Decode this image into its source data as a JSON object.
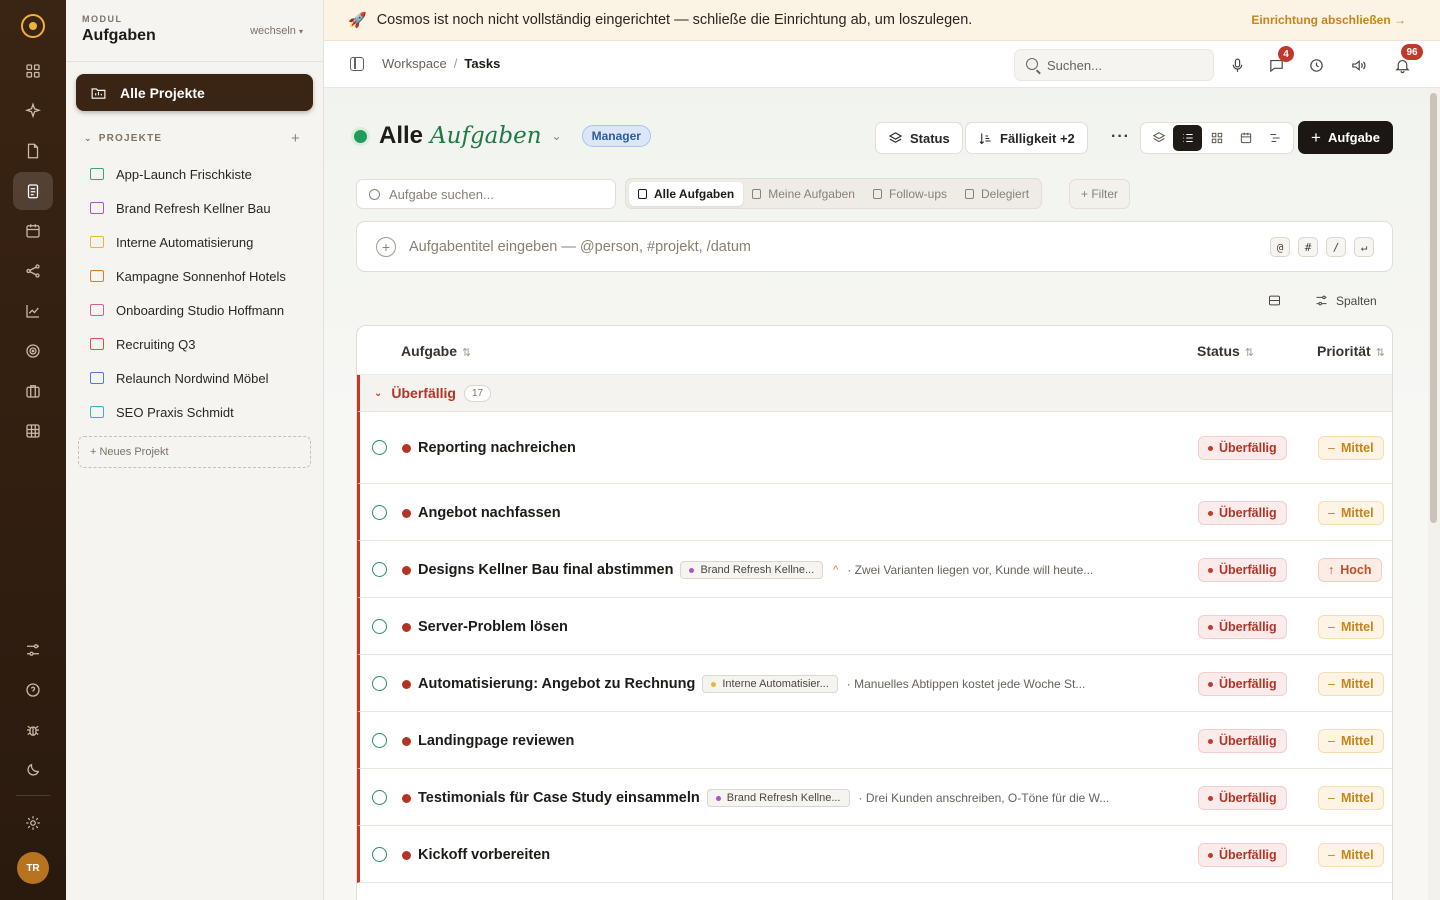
{
  "rail": {
    "avatar_initials": "TR"
  },
  "sidebar": {
    "module_label": "MODUL",
    "module_title": "Aufgaben",
    "switch_label": "wechseln",
    "switch_caret": "▾",
    "all_projects_label": "Alle Projekte",
    "projects_heading": "PROJEKTE",
    "projects_heading_chevron": "⌄",
    "add_project_glyph": "+",
    "projects": [
      {
        "label": "App-Launch Frischkiste",
        "color": "#3aa876"
      },
      {
        "label": "Brand Refresh Kellner Bau",
        "color": "#a855c7"
      },
      {
        "label": "Interne Automatisierung",
        "color": "#e8b63a"
      },
      {
        "label": "Kampagne Sonnenhof Hotels",
        "color": "#e07b2a"
      },
      {
        "label": "Onboarding Studio Hoffmann",
        "color": "#d65c9a"
      },
      {
        "label": "Recruiting Q3",
        "color": "#d9534f"
      },
      {
        "label": "Relaunch Nordwind Möbel",
        "color": "#4a7fd4"
      },
      {
        "label": "SEO Praxis Schmidt",
        "color": "#3ab0c9"
      }
    ],
    "new_project_label": "+ Neues Projekt"
  },
  "banner": {
    "text": "Cosmos ist noch nicht vollständig eingerichtet — schließe die Einrichtung ab, um loszulegen.",
    "cta": "Einrichtung abschließen →"
  },
  "topbar": {
    "breadcrumb": [
      "Workspace",
      "Tasks"
    ],
    "breadcrumb_sep": "/",
    "search_placeholder": "Suchen...",
    "messages_badge": "4",
    "notifications_badge": "96"
  },
  "header": {
    "title_plain": "Alle",
    "title_accent": "Aufgaben",
    "title_caret": "⌄",
    "role_badge": "Manager",
    "status_button": "Status",
    "due_button": "Fälligkeit +2",
    "more_glyph": "···",
    "add_button": "Aufgabe",
    "add_glyph": "+"
  },
  "toolbar": {
    "task_search_placeholder": "Aufgabe suchen...",
    "filters": [
      {
        "label": "Alle Aufgaben",
        "active": true
      },
      {
        "label": "Meine Aufgaben",
        "active": false
      },
      {
        "label": "Follow-ups",
        "active": false
      },
      {
        "label": "Delegiert",
        "active": false
      }
    ],
    "filter_button": "+ Filter",
    "quick_add_placeholder": "Aufgabentitel eingeben — @person, #projekt, /datum",
    "quick_add_glyph": "+",
    "shortcuts": [
      "@",
      "#",
      "/",
      "↵"
    ],
    "columns_button": "Spalten"
  },
  "table": {
    "columns": [
      {
        "label": "Aufgabe",
        "sort": "⇅"
      },
      {
        "label": "Status",
        "sort": "⇅"
      },
      {
        "label": "Priorität",
        "sort": "⇅"
      }
    ],
    "group": {
      "label": "Überfällig",
      "count": "17",
      "chevron": "⌄"
    },
    "rows": [
      {
        "title": "Reporting nachreichen",
        "status": "Überfällig",
        "priority": "Mittel",
        "priority_icon": "–",
        "high": false
      },
      {
        "title": "Angebot nachfassen",
        "status": "Überfällig",
        "priority": "Mittel",
        "priority_icon": "–",
        "high": false
      },
      {
        "title": "Designs Kellner Bau final abstimmen",
        "tag": "Brand Refresh Kellne...",
        "tag_color": "#a855c7",
        "up_glyph": "^",
        "desc": "· Zwei Varianten liegen vor, Kunde will heute...",
        "status": "Überfällig",
        "priority": "Hoch",
        "priority_icon": "↑",
        "high": true
      },
      {
        "title": "Server-Problem lösen",
        "status": "Überfällig",
        "priority": "Mittel",
        "priority_icon": "–",
        "high": false
      },
      {
        "title": "Automatisierung: Angebot zu Rechnung",
        "tag": "Interne Automatisier...",
        "tag_color": "#e8b63a",
        "desc": "· Manuelles Abtippen kostet jede Woche St...",
        "status": "Überfällig",
        "priority": "Mittel",
        "priority_icon": "–",
        "high": false
      },
      {
        "title": "Landingpage reviewen",
        "status": "Überfällig",
        "priority": "Mittel",
        "priority_icon": "–",
        "high": false
      },
      {
        "title": "Testimonials für Case Study einsammeln",
        "tag": "Brand Refresh Kellne...",
        "tag_color": "#a855c7",
        "desc": "· Drei Kunden anschreiben, O-Töne für die W...",
        "status": "Überfällig",
        "priority": "Mittel",
        "priority_icon": "–",
        "high": false
      },
      {
        "title": "Kickoff vorbereiten",
        "status": "Überfällig",
        "priority": "Mittel",
        "priority_icon": "–",
        "high": false
      }
    ]
  }
}
